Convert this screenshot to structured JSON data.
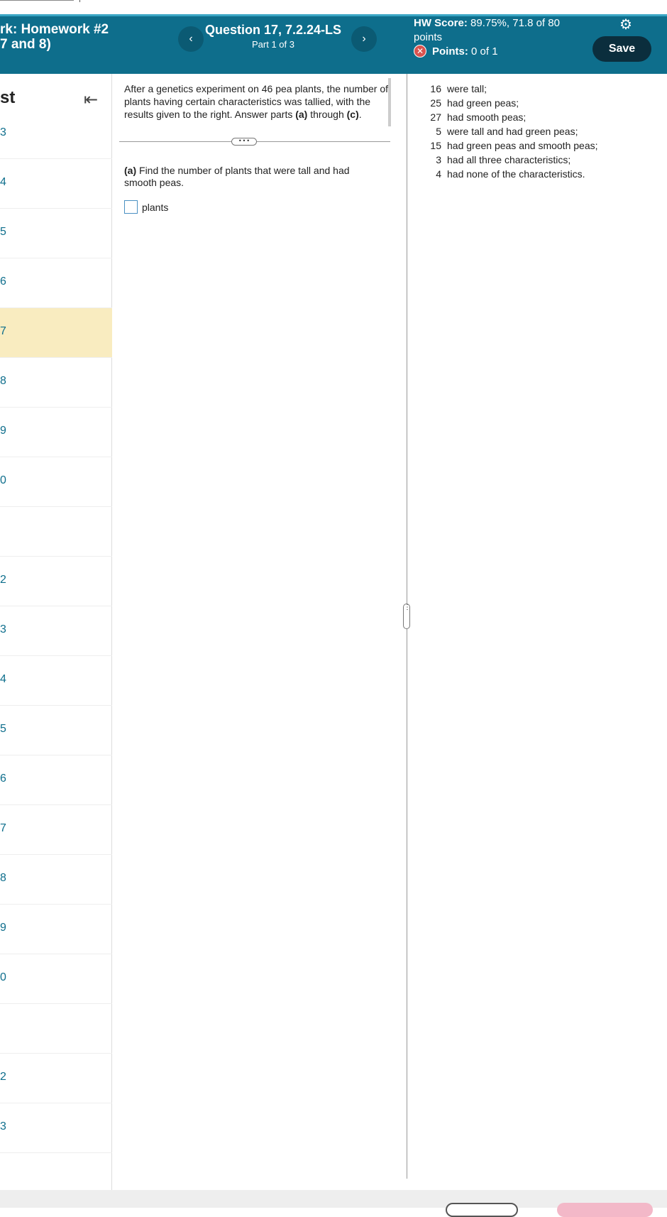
{
  "header": {
    "hw_title_line1": "rk:  Homework #2",
    "hw_title_line2": "7 and 8)",
    "prev_label": "‹",
    "next_label": "›",
    "question_title": "Question 17, 7.2.24-LS",
    "question_part": "Part 1 of 3",
    "score_label": "HW Score:",
    "score_value": "89.75%, 71.8 of 80",
    "score_unit": "points",
    "points_label": "Points:",
    "points_value": "0 of 1",
    "save_label": "Save"
  },
  "sidebar": {
    "heading": "st",
    "collapse_icon": "collapse-left-icon",
    "items": [
      {
        "label": "3"
      },
      {
        "label": "4"
      },
      {
        "label": "5"
      },
      {
        "label": "6"
      },
      {
        "label": "7",
        "active": true
      },
      {
        "label": "8"
      },
      {
        "label": "9"
      },
      {
        "label": "0"
      },
      {
        "label": ""
      },
      {
        "label": "2"
      },
      {
        "label": "3"
      },
      {
        "label": "4"
      },
      {
        "label": "5"
      },
      {
        "label": "6"
      },
      {
        "label": "7"
      },
      {
        "label": "8"
      },
      {
        "label": "9"
      },
      {
        "label": "0"
      },
      {
        "label": ""
      },
      {
        "label": "2"
      },
      {
        "label": "3"
      }
    ]
  },
  "question": {
    "intro": "After a genetics experiment on 46 pea plants, the number of plants having certain characteristics was tallied, with the results given to the right. Answer parts",
    "intro_a": "(a)",
    "intro_mid": "through",
    "intro_c": "(c)",
    "part_a_label": "(a)",
    "part_a_text": "Find the number of plants that were tall and had smooth peas.",
    "answer_value": "",
    "answer_unit": "plants"
  },
  "data": [
    {
      "n": "16",
      "text": "were tall;"
    },
    {
      "n": "25",
      "text": "had green peas;"
    },
    {
      "n": "27",
      "text": "had smooth peas;"
    },
    {
      "n": "5",
      "text": "were tall and had green peas;"
    },
    {
      "n": "15",
      "text": "had green peas and smooth peas;"
    },
    {
      "n": "3",
      "text": "had all three characteristics;"
    },
    {
      "n": "4",
      "text": "had none of the characteristics."
    }
  ]
}
